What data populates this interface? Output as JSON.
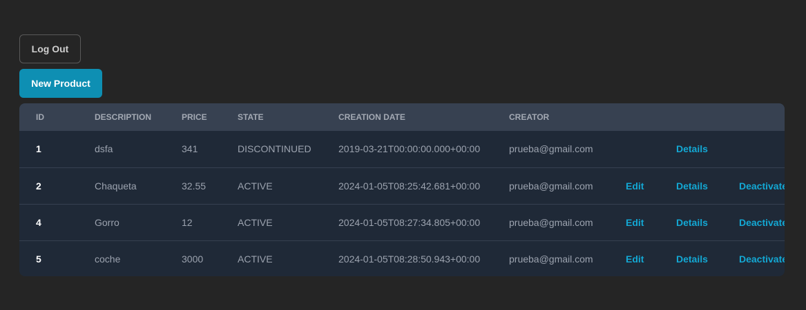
{
  "buttons": {
    "logout_label": "Log Out",
    "new_product_label": "New Product"
  },
  "colors": {
    "background": "#252525",
    "primary_button": "#0e8fb3",
    "link": "#13a8d4",
    "table_header": "#374151",
    "table_body": "#1f2937"
  },
  "table": {
    "headers": {
      "id": "ID",
      "description": "DESCRIPTION",
      "price": "PRICE",
      "state": "STATE",
      "creation_date": "CREATION DATE",
      "creator": "CREATOR"
    },
    "rows": [
      {
        "id": "1",
        "description": "dsfa",
        "price": "341",
        "state": "DISCONTINUED",
        "creation_date": "2019-03-21T00:00:00.000+00:00",
        "creator": "prueba@gmail.com",
        "edit": "",
        "details": "Details",
        "deactivate": ""
      },
      {
        "id": "2",
        "description": "Chaqueta",
        "price": "32.55",
        "state": "ACTIVE",
        "creation_date": "2024-01-05T08:25:42.681+00:00",
        "creator": "prueba@gmail.com",
        "edit": "Edit",
        "details": "Details",
        "deactivate": "Deactivate"
      },
      {
        "id": "4",
        "description": "Gorro",
        "price": "12",
        "state": "ACTIVE",
        "creation_date": "2024-01-05T08:27:34.805+00:00",
        "creator": "prueba@gmail.com",
        "edit": "Edit",
        "details": "Details",
        "deactivate": "Deactivate"
      },
      {
        "id": "5",
        "description": "coche",
        "price": "3000",
        "state": "ACTIVE",
        "creation_date": "2024-01-05T08:28:50.943+00:00",
        "creator": "prueba@gmail.com",
        "edit": "Edit",
        "details": "Details",
        "deactivate": "Deactivate"
      }
    ]
  }
}
